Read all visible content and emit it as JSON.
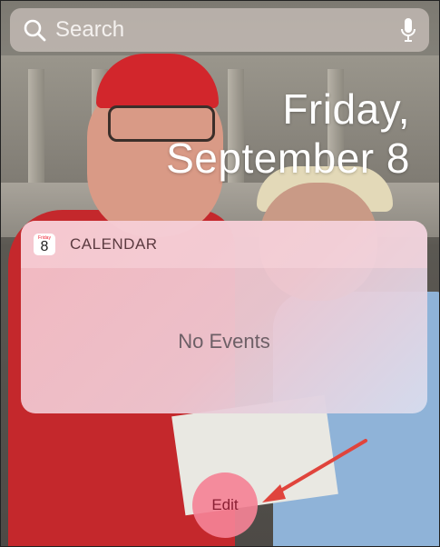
{
  "search": {
    "placeholder": "Search",
    "icon": "search-icon",
    "mic_icon": "microphone-icon"
  },
  "date": {
    "line1": "Friday,",
    "line2": "September 8"
  },
  "widget": {
    "icon_day_of_week": "Friday",
    "icon_day": "8",
    "title": "CALENDAR",
    "message": "No Events"
  },
  "edit_button": {
    "label": "Edit"
  },
  "colors": {
    "annotation_arrow": "#e0443c"
  }
}
